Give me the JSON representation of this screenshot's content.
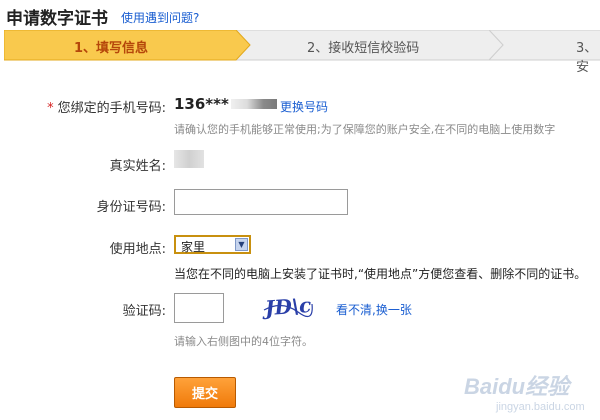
{
  "header": {
    "title": "申请数字证书",
    "help_link": "使用遇到问题?"
  },
  "steps": [
    {
      "label": "1、填写信息",
      "active": true
    },
    {
      "label": "2、接收短信校验码",
      "active": false
    },
    {
      "label": "3、安",
      "active": false
    }
  ],
  "form": {
    "phone": {
      "required_mark": "*",
      "label": "您绑定的手机号码:",
      "value": "136***",
      "change_link": "更换号码",
      "hint": "请确认您的手机能够正常使用;为了保障您的账户安全,在不同的电脑上使用数字"
    },
    "real_name": {
      "label": "真实姓名:"
    },
    "id_number": {
      "label": "身份证号码:",
      "value": ""
    },
    "location": {
      "label": "使用地点:",
      "selected": "家里",
      "note": "当您在不同的电脑上安装了证书时,“使用地点”方便您查看、删除不同的证书。"
    },
    "captcha": {
      "label": "验证码:",
      "value": "",
      "image_text": "JD\\c",
      "refresh_link": "看不清,换一张",
      "hint": "请输入右侧图中的4位字符。"
    },
    "submit_label": "提交"
  },
  "watermark": {
    "brand": "Baidu经验",
    "url": "jingyan.baidu.com"
  },
  "colors": {
    "step_active": "#f9c94d",
    "step_inactive": "#eeeeee",
    "link": "#1a5ed1",
    "required": "#d41f1f",
    "submit": "#f58a1c"
  }
}
